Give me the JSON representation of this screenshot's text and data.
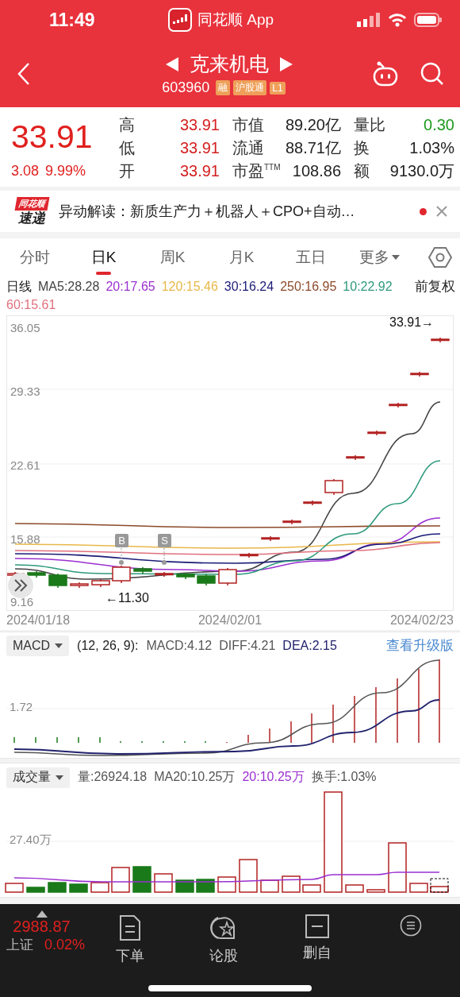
{
  "status_bar": {
    "time": "11:49",
    "app_label": "同花顺 App"
  },
  "header": {
    "title": "克来机电",
    "code": "603960",
    "tags": [
      "融",
      "沪股通",
      "L1"
    ]
  },
  "quote": {
    "price": "33.91",
    "change": "3.08",
    "change_pct": "9.99%",
    "color": "#e0201e",
    "stats": [
      {
        "label": "高",
        "value": "33.91",
        "color": "#d42020"
      },
      {
        "label": "市值",
        "value": "89.20亿",
        "color": "#222222"
      },
      {
        "label": "量比",
        "value": "0.30",
        "color": "#1e9a1e"
      },
      {
        "label": "低",
        "value": "33.91",
        "color": "#d42020"
      },
      {
        "label": "流通",
        "value": "88.71亿",
        "color": "#222222"
      },
      {
        "label": "换",
        "value": "1.03%",
        "color": "#222222"
      },
      {
        "label": "开",
        "value": "33.91",
        "color": "#d42020"
      },
      {
        "label": "市盈$^{TTM}$",
        "value": "108.86",
        "color": "#222222"
      },
      {
        "label": "额",
        "value": "9130.0万",
        "color": "#222222"
      }
    ]
  },
  "news": {
    "logo_top": "同花顺",
    "logo_bottom": "速递",
    "text": "异动解读：新质生产力＋机器人＋CPO+自动…",
    "unread": true
  },
  "period_tabs": [
    {
      "label": "分时",
      "selected": false,
      "kind": "tab"
    },
    {
      "label": "日K",
      "selected": true,
      "kind": "tab"
    },
    {
      "label": "周K",
      "selected": false,
      "kind": "tab"
    },
    {
      "label": "月K",
      "selected": false,
      "kind": "tab"
    },
    {
      "label": "五日",
      "selected": false,
      "kind": "tab"
    },
    {
      "label": "更多",
      "selected": false,
      "kind": "menu"
    }
  ],
  "legend": {
    "title": "日线",
    "adjust": "前复权",
    "items": [
      {
        "label": "MA5:28.28",
        "color": "#444444"
      },
      {
        "label": "20:17.65",
        "color": "#9b30d0"
      },
      {
        "label": "120:15.46",
        "color": "#e8b84a"
      },
      {
        "label": "30:16.24",
        "color": "#1c1c78"
      },
      {
        "label": "250:16.95",
        "color": "#8c4a2a"
      },
      {
        "label": "10:22.92",
        "color": "#2e9a7c"
      },
      {
        "label": "60:15.61",
        "color": "#e0707e"
      }
    ]
  },
  "kline": {
    "y_labels": [
      "36.05",
      "29.33",
      "22.61",
      "15.88",
      "9.16"
    ],
    "dates": [
      "2024/01/18",
      "2024/02/01",
      "2024/02/23"
    ],
    "high_label": "33.91→",
    "low_label": "←11.30",
    "markers": [
      "B",
      "S"
    ]
  },
  "macd": {
    "indicator": "MACD",
    "params": "(12, 26, 9):",
    "values": [
      {
        "label": "MACD:4.12",
        "color": "#555555"
      },
      {
        "label": "DIFF:4.21",
        "color": "#555555"
      },
      {
        "label": "DEA:2.15",
        "color": "#22226e"
      }
    ],
    "upgrade_link": "查看升级版",
    "y_label": "1.72"
  },
  "volume": {
    "indicator": "成交量",
    "values": [
      {
        "label": "量:26924.18",
        "color": "#555555"
      },
      {
        "label": "MA20:10.25万",
        "color": "#555555"
      },
      {
        "label": "20:10.25万",
        "color": "#9b30d0"
      },
      {
        "label": "换手:1.03%",
        "color": "#555555"
      }
    ],
    "y_label": "27.40万"
  },
  "bottom_bar": {
    "index": {
      "value": "2988.87",
      "name": "上证",
      "change": "0.02%",
      "color": "#e0201e"
    },
    "items": [
      {
        "label": "下单",
        "kind": "order"
      },
      {
        "label": "论股",
        "kind": "discuss"
      },
      {
        "label": "删自",
        "kind": "remove"
      },
      {
        "kind": "menu"
      }
    ]
  }
}
